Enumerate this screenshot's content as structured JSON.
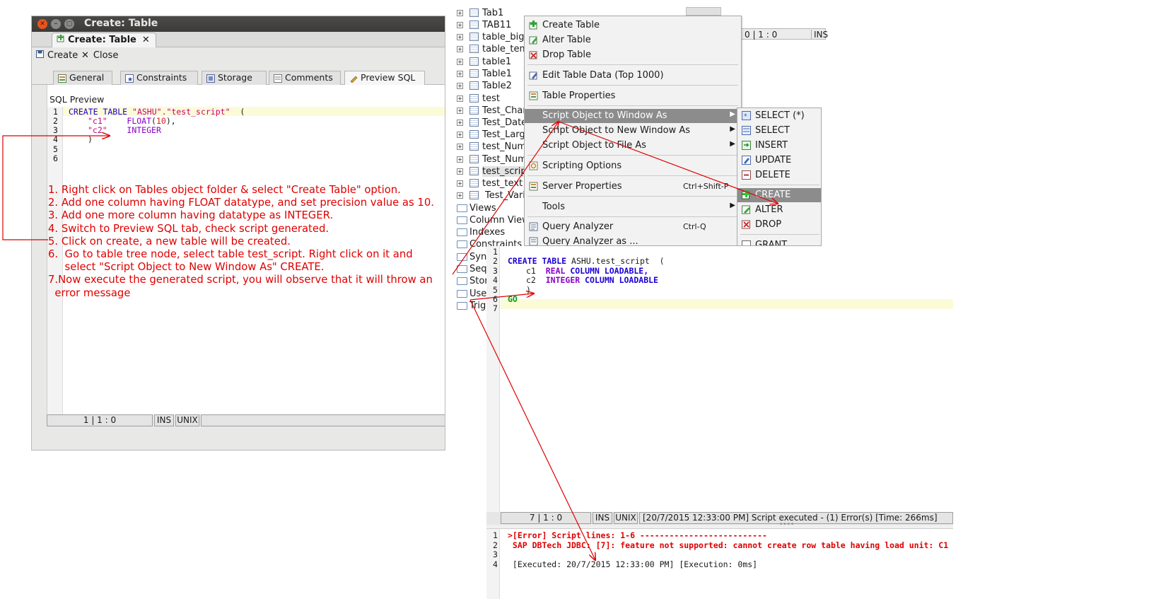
{
  "left_window": {
    "title": "Create: Table",
    "doc_tab": "Create: Table",
    "doc_tab_close": "✕",
    "toolbar": {
      "create": "Create",
      "close": "Close"
    },
    "tabs": [
      "General",
      "Constraints",
      "Storage",
      "Comments",
      "Preview SQL"
    ],
    "sql_preview_label": "SQL Preview",
    "line_numbers": [
      "1",
      "2",
      "3",
      "4",
      "5",
      "6"
    ],
    "code": {
      "l1_kw": "CREATE TABLE",
      "l1_str": "\"ASHU\".\"test_script\"",
      "l1_rest": "  (",
      "l2_col": "\"c1\"",
      "l2_type": "FLOAT",
      "l2_num": "10",
      "l3_col": "\"c2\"",
      "l3_type": "INTEGER",
      "l4": ")"
    },
    "status": {
      "pos": "1 | 1 : 0",
      "ins": "INS",
      "eol": "UNIX"
    }
  },
  "instructions": [
    "1. Right click on Tables object folder & select \"Create Table\" option.",
    "2. Add one column having FLOAT datatype, and set precision value as 10.",
    "3. Add one more column having datatype as INTEGER.",
    "4. Switch to Preview SQL tab, check script generated.",
    "5. Click on create, a new table will be created.",
    "6.  Go to table tree node, select table test_script. Right click on it and",
    "     select \"Script Object to New Window As\" CREATE.",
    "7.Now execute the generated script, you will observe that it will throw an",
    "  error message"
  ],
  "tree": {
    "tables": [
      "Tab1",
      "TAB11",
      "table_bigi",
      "table_tem",
      "table1",
      "Table1",
      "Table2",
      "test",
      "Test_Char",
      "Test_Date",
      "Test_Larg",
      "test_Num",
      "Test_Num",
      "test_scrip",
      "test_text",
      "Test_Vari"
    ],
    "folders": [
      "Views",
      "Column Views",
      "Indexes",
      "Constraints",
      "Syno",
      "Seq",
      "Stor",
      "Use",
      "Trig"
    ],
    "pos_strip": {
      "pos": "0 | 1 : 0",
      "ins": "INS"
    }
  },
  "context_menu": {
    "items": [
      {
        "label": "Create Table",
        "icon": "create-table-icon"
      },
      {
        "label": "Alter Table",
        "icon": "alter-table-icon"
      },
      {
        "label": "Drop Table",
        "icon": "drop-table-icon"
      },
      {
        "label": "Edit Table Data (Top 1000)",
        "icon": "edit-data-icon"
      },
      {
        "label": "Table Properties",
        "icon": "table-properties-icon"
      },
      {
        "label": "Script Object to Window As",
        "icon": ""
      },
      {
        "label": "Script Object to New Window As",
        "icon": ""
      },
      {
        "label": "Script Object to File As",
        "icon": ""
      },
      {
        "label": "Scripting Options",
        "icon": "scripting-options-icon"
      },
      {
        "label": "Server Properties",
        "icon": "server-properties-icon",
        "shortcut": "Ctrl+Shift-P"
      },
      {
        "label": "Tools",
        "icon": ""
      },
      {
        "label": "Query Analyzer",
        "icon": "query-analyzer-icon",
        "shortcut": "Ctrl-Q"
      },
      {
        "label": "Query Analyzer as ...",
        "icon": "query-analyzer-as-icon"
      }
    ]
  },
  "submenu": {
    "items": [
      "SELECT (*)",
      "SELECT",
      "INSERT",
      "UPDATE",
      "DELETE",
      "CREATE",
      "ALTER",
      "DROP",
      "GRANT"
    ]
  },
  "script_editor": {
    "line_numbers": [
      "1",
      "2",
      "3",
      "4",
      "5",
      "6",
      "7"
    ],
    "l1_kw": "CREATE TABLE",
    "l1_name": "ASHU.test_script",
    "l1_rest": "  (",
    "l2_col": "c1",
    "l2_type": "REAL",
    "l2_kw": "COLUMN LOADABLE,",
    "l3_col": "c2",
    "l3_type": "INTEGER",
    "l3_kw": "COLUMN LOADABLE",
    "l4": ")",
    "l6": "GO"
  },
  "status_right": {
    "pos": "7 | 1 : 0",
    "ins": "INS",
    "eol": "UNIX",
    "message": "[20/7/2015 12:33:00 PM] Script executed - (1) Error(s) [Time: 266ms]"
  },
  "output": {
    "line_numbers": [
      "1",
      "2",
      "3",
      "4"
    ],
    "l1": ">[Error] Script lines: 1-6 --------------------------",
    "l2": " SAP DBTech JDBC: [7]: feature not supported: cannot create row table having load unit: C1",
    "l4": " [Executed: 20/7/2015 12:33:00 PM] [Execution: 0ms]"
  },
  "colors": {
    "annotation_red": "#e00000",
    "keyword_blue": "#1c00d4",
    "type_purple": "#8a00c8",
    "string_magenta": "#c8007c"
  }
}
